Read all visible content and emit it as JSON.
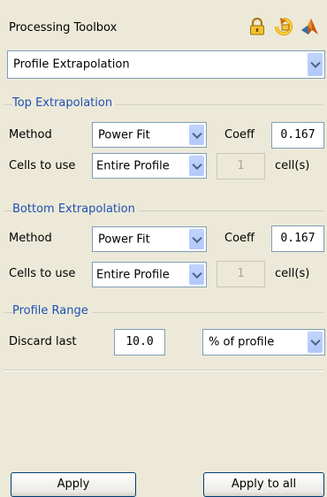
{
  "window": {
    "title": "Processing Toolbox",
    "icons": [
      "lock-icon",
      "undo-arrow-icon",
      "matlab-icon"
    ]
  },
  "tool_select": {
    "value": "Profile Extrapolation"
  },
  "top": {
    "heading": "Top Extrapolation",
    "method_label": "Method",
    "method_value": "Power Fit",
    "coeff_label": "Coeff",
    "coeff_value": "0.167",
    "cells_label": "Cells to use",
    "cells_value": "Entire Profile",
    "cells_count": "1",
    "cells_unit": "cell(s)"
  },
  "bottom": {
    "heading": "Bottom Extrapolation",
    "method_label": "Method",
    "method_value": "Power Fit",
    "coeff_label": "Coeff",
    "coeff_value": "0.167",
    "cells_label": "Cells to use",
    "cells_value": "Entire Profile",
    "cells_count": "1",
    "cells_unit": "cell(s)"
  },
  "range": {
    "heading": "Profile Range",
    "discard_label": "Discard last",
    "discard_value": "10.0",
    "unit_value": "% of profile"
  },
  "buttons": {
    "apply": "Apply",
    "apply_all": "Apply to all"
  }
}
